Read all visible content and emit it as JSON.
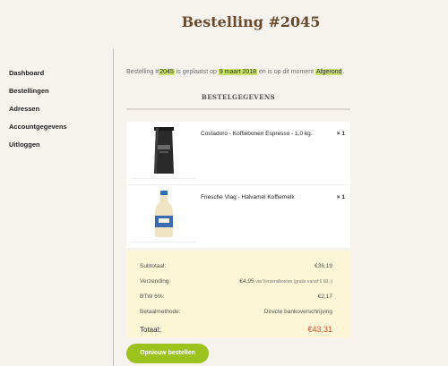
{
  "page_title": "Bestelling #2045",
  "sidebar": {
    "items": [
      {
        "label": "Dashboard"
      },
      {
        "label": "Bestellingen"
      },
      {
        "label": "Adressen"
      },
      {
        "label": "Accountgegevens"
      },
      {
        "label": "Uitloggen"
      }
    ]
  },
  "summary": {
    "prefix": "Bestelling #",
    "order_number": "2045",
    "middle": " is geplaatst op ",
    "date": "9 maart 2018",
    "suffix": " en is op dit moment ",
    "status": "Afgerond",
    "end": "."
  },
  "section_heading": "BESTELGEGEVENS",
  "items": [
    {
      "name": "Costadoro - Koffiebonen Espresso - 1,0 kg.",
      "qty": "× 1",
      "icon": "coffee-bag"
    },
    {
      "name": "Friesche Vlag - Halvamel Koffiemelk",
      "qty": "× 1",
      "icon": "milk-bottle"
    }
  ],
  "totals": {
    "subtotal_label": "Subtotaal:",
    "subtotal_value": "€36,19",
    "shipping_label": "Verzending:",
    "shipping_value": "€4,95",
    "shipping_note": "via Verzendkosten (gratis vanaf € 60,-)",
    "vat_label": "BTW 6%:",
    "vat_value": "€2,17",
    "payment_label": "Betaalmethode:",
    "payment_value": "Directe bankoverschrijving",
    "total_label": "Totaal:",
    "total_value": "€43,31"
  },
  "reorder_button": "Opnieuw bestellen",
  "colors": {
    "background": "#f6f3ef",
    "title": "#6b4a2b",
    "highlight": "#c7e169",
    "totals_bg": "#fdf6d6",
    "total_value": "#d94f2b",
    "button": "#9cc21d"
  }
}
